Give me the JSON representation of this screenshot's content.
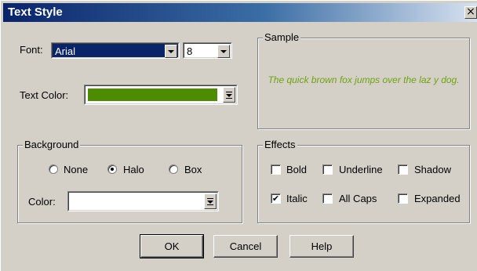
{
  "window": {
    "title": "Text Style",
    "close_glyph": "×"
  },
  "font": {
    "label": "Font:",
    "family": "Arial",
    "size": "8"
  },
  "text_color": {
    "label": "Text Color:",
    "swatch": "#4d8c00"
  },
  "sample": {
    "legend": "Sample",
    "text": "The quick brown fox jumps over the laz y dog.",
    "text_color": "#6fa310"
  },
  "background": {
    "legend": "Background",
    "options": [
      {
        "label": "None",
        "selected": false
      },
      {
        "label": "Halo",
        "selected": true
      },
      {
        "label": "Box",
        "selected": false
      }
    ],
    "color_label": "Color:",
    "color_value": "#ffffff"
  },
  "effects": {
    "legend": "Effects",
    "items": [
      {
        "label": "Bold",
        "checked": false
      },
      {
        "label": "Underline",
        "checked": false
      },
      {
        "label": "Shadow",
        "checked": false
      },
      {
        "label": "Italic",
        "checked": true
      },
      {
        "label": "All Caps",
        "checked": false
      },
      {
        "label": "Expanded",
        "checked": false
      }
    ]
  },
  "buttons": {
    "ok": "OK",
    "cancel": "Cancel",
    "help": "Help"
  },
  "colors": {
    "title_bar": "#0a246a",
    "dialog_face": "#d4d0c8",
    "selection": "#0a246a"
  }
}
